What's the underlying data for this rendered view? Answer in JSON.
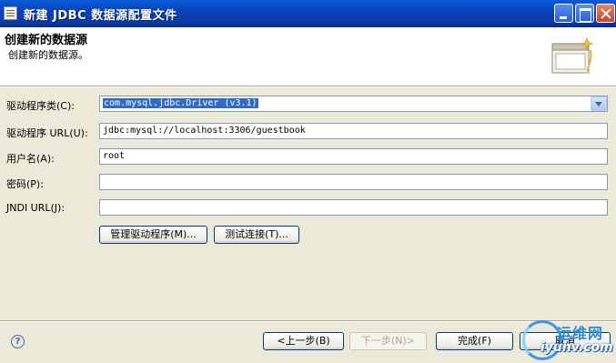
{
  "window": {
    "title": "新建 JDBC 数据源配置文件"
  },
  "banner": {
    "title": "创建新的数据源",
    "subtitle": "创建新的数据源。"
  },
  "form": {
    "driver_class": {
      "label": "驱动程序类(C):",
      "value": "com.mysql.jdbc.Driver (v3.1)"
    },
    "driver_url": {
      "label": "驱动程序 URL(U):",
      "value": "jdbc:mysql://localhost:3306/guestbook"
    },
    "username": {
      "label": "用户名(A):",
      "value": "root"
    },
    "password": {
      "label": "密码(P):",
      "value": ""
    },
    "jndi_url": {
      "label": "JNDI URL(J):",
      "value": ""
    }
  },
  "buttons": {
    "manage_drivers": "管理驱动程序(M)...",
    "test_connection": "测试连接(T)...",
    "back": "<上一步(B)",
    "next": "下一步(N)>",
    "finish": "完成(F)",
    "cancel": "取消"
  },
  "help": {
    "symbol": "?"
  },
  "watermark": {
    "cn": "运维网",
    "en": "iyunv.com"
  },
  "colors": {
    "title_bar": "#0840b8",
    "selection": "#316ac5",
    "dialog_bg": "#ece9d8"
  },
  "icons": [
    "app-window-icon",
    "minimize-icon",
    "maximize-icon",
    "close-icon",
    "wizard-banner-icon",
    "dropdown-arrow-icon",
    "help-icon"
  ]
}
